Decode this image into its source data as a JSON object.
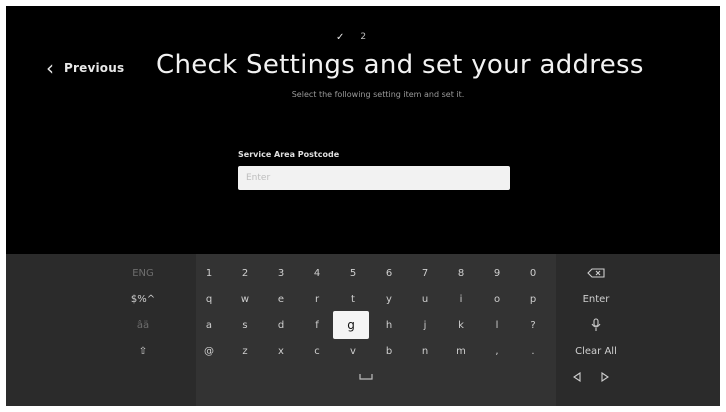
{
  "steps": {
    "done_mark": "✓",
    "current": "2"
  },
  "nav": {
    "previous_label": "Previous"
  },
  "header": {
    "title": "Check Settings and set your address",
    "subtitle": "Select the following setting item and set it."
  },
  "form": {
    "field_label": "Service Area Postcode",
    "field_placeholder": "Enter",
    "field_value": ""
  },
  "keyboard": {
    "side_keys": [
      "ENG",
      "$%^",
      "âä",
      "⇧"
    ],
    "rows": [
      [
        "1",
        "2",
        "3",
        "4",
        "5",
        "6",
        "7",
        "8",
        "9",
        "0"
      ],
      [
        "q",
        "w",
        "e",
        "r",
        "t",
        "y",
        "u",
        "i",
        "o",
        "p"
      ],
      [
        "a",
        "s",
        "d",
        "f",
        "g",
        "h",
        "j",
        "k",
        "l",
        "?"
      ],
      [
        "@",
        "z",
        "x",
        "c",
        "v",
        "b",
        "n",
        "m",
        ",",
        "."
      ]
    ],
    "focused_key": "g",
    "space_icon": "space-bar-icon",
    "right_keys": {
      "backspace_icon": "backspace-icon",
      "enter_label": "Enter",
      "mic_icon": "microphone-icon",
      "clear_all_label": "Clear All",
      "cursor_left_icon": "cursor-left-icon",
      "cursor_right_icon": "cursor-right-icon"
    }
  }
}
